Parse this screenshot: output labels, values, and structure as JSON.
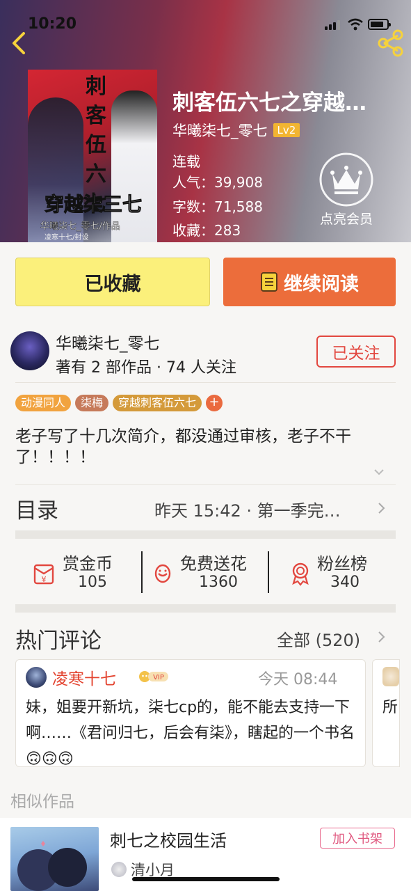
{
  "status_bar": {
    "time": "10:20"
  },
  "book": {
    "title": "刺客伍六七之穿越…",
    "author": "华曦柒七_零七",
    "level": "Lv2",
    "status": "连载",
    "popularity": "人气：39,908",
    "words": "字数：71,588",
    "favorites": "收藏：283",
    "cover": {
      "title_vertical": [
        "刺",
        "客",
        "伍",
        "六",
        "七"
      ],
      "subtitle": "穿越柒三七",
      "author_credit": "华曦柒七_零七/作品",
      "editor_credit": "凌寒十七/封设"
    }
  },
  "member": {
    "label": "点亮会员"
  },
  "actions": {
    "favorited": "已收藏",
    "continue_reading": "继续阅读"
  },
  "author_row": {
    "name": "华曦柒七_零七",
    "stats": "著有 2 部作品 · 74 人关注",
    "follow": "已关注"
  },
  "tags": [
    {
      "label": "动漫同人",
      "color": "#f1a33f"
    },
    {
      "label": "柒梅",
      "color": "#c67a5a"
    },
    {
      "label": "穿越刺客伍六七",
      "color": "#d49a3a"
    }
  ],
  "tag_add": "+",
  "intro": "老子写了十几次简介，都没通过审核，老子不干了！！！！",
  "toc": {
    "label": "目录",
    "info": "昨天 15:42 · 第一季完…"
  },
  "stats": [
    {
      "label": "赏金币",
      "value": "105"
    },
    {
      "label": "免费送花",
      "value": "1360"
    },
    {
      "label": "粉丝榜",
      "value": "340"
    }
  ],
  "hot_comments": {
    "label": "热门评论",
    "all": "全部 (520)",
    "items": [
      {
        "user": "凌寒十七",
        "badge": "VIP",
        "time": "今天 08:44",
        "text": "妹，姐要开新坑，柒七cp的，能不能去支持一下啊……《君问归七，后会有柒》，瞎起的一个书名🙃🙃🙃"
      },
      {
        "text": "所"
      }
    ]
  },
  "similar": {
    "label": "相似作品",
    "items": [
      {
        "title": "刺七之校园生活",
        "author": "清小月",
        "action": "加入书架"
      }
    ]
  },
  "colors": {
    "accent_orange": "#ec6d3b",
    "fav_yellow": "#fbf07b",
    "follow_red": "#e2473f",
    "level_gold": "#f2b531"
  }
}
